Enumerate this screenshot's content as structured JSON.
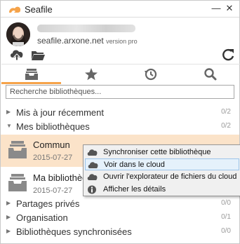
{
  "window": {
    "title": "Seafile",
    "minimize_glyph": "—",
    "close_glyph": "✕"
  },
  "account": {
    "server": "seafile.arxone.net",
    "version": "version pro"
  },
  "toolbar": {
    "icons": [
      "cloud-upload-icon",
      "folder-icon",
      "refresh-icon"
    ]
  },
  "tabs": [
    {
      "name": "libraries",
      "icon": "inbox-tray-icon",
      "active": true
    },
    {
      "name": "starred",
      "icon": "star-icon",
      "active": false
    },
    {
      "name": "activity",
      "icon": "history-clock-icon",
      "active": false
    },
    {
      "name": "search",
      "icon": "magnifier-icon",
      "active": false
    }
  ],
  "search": {
    "placeholder": "Recherche bibliothèques...",
    "value": ""
  },
  "tree": {
    "recent": {
      "label": "Mis à jour récemment",
      "count": "0/2",
      "expanded": false
    },
    "mine": {
      "label": "Mes bibliothèques",
      "count": "0/2",
      "expanded": true
    },
    "shared": {
      "label": "Partages privés",
      "count": "0/0",
      "expanded": false
    },
    "org": {
      "label": "Organisation",
      "count": "0/1",
      "expanded": false
    },
    "synced": {
      "label": "Bibliothèques synchronisées",
      "count": "0/0",
      "expanded": false
    }
  },
  "libraries": [
    {
      "name": "Commun",
      "date": "2015-07-27",
      "selected": true
    },
    {
      "name": "Ma bibliothèque",
      "date": "2015-07-27",
      "selected": false
    }
  ],
  "context_menu": {
    "items": [
      {
        "label": "Synchroniser cette bibliothèque",
        "icon": "cloud-sync-icon"
      },
      {
        "label": "Voir dans le cloud",
        "icon": "cloud-view-icon",
        "highlighted": true
      },
      {
        "label": "Ouvrir l'explorateur de fichiers du cloud",
        "icon": "cloud-browser-icon"
      },
      {
        "label": "Afficher les détails",
        "icon": "info-icon"
      }
    ]
  },
  "colors": {
    "accent": "#f5a34a",
    "selected_row": "#fbe3c9",
    "menu_highlight": "#e5f1fb"
  }
}
